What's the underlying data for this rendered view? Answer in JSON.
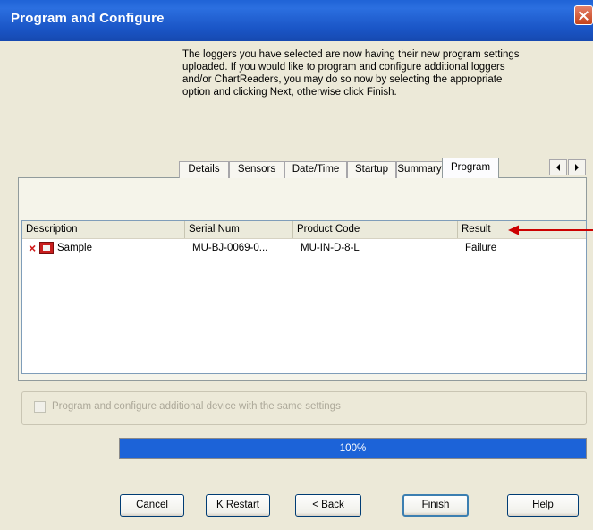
{
  "window": {
    "title": "Program and Configure"
  },
  "intro": {
    "lines": [
      "The loggers you have selected are now having their new program settings",
      "uploaded. If you would like to program and configure additional loggers",
      "and/or ChartReaders, you may do so now by selecting the appropriate",
      "option and clicking Next, otherwise click Finish."
    ]
  },
  "tabs": [
    {
      "label": "Details"
    },
    {
      "label": "Sensors"
    },
    {
      "label": "Date/Time"
    },
    {
      "label": "Startup"
    },
    {
      "label": "Summary"
    },
    {
      "label": "Program",
      "active": true
    }
  ],
  "table": {
    "columns": [
      "Description",
      "Serial Num",
      "Product Code",
      "Result"
    ],
    "rows": [
      {
        "description": "Sample",
        "serial": "MU-BJ-0069-0...",
        "product": "MU-IN-D-8-L",
        "result": "Failure"
      }
    ]
  },
  "options": {
    "checkbox_label": "Program and configure additional device with the same settings",
    "checked": false,
    "enabled": false
  },
  "progress": {
    "text": "100%",
    "value": 1.0
  },
  "buttons": {
    "cancel": "Cancel",
    "restart_prefix": "K ",
    "restart_key": "R",
    "restart_rest": "estart",
    "back_prefix": "< ",
    "back_key": "B",
    "back_rest": "ack",
    "finish_key": "F",
    "finish_rest": "inish",
    "help_key": "H",
    "help_rest": "elp"
  },
  "colors": {
    "titlebar": "#1f63d6",
    "progress": "#1e5fcf",
    "failure": "#d21a1a",
    "arrow": "#cc0000"
  }
}
